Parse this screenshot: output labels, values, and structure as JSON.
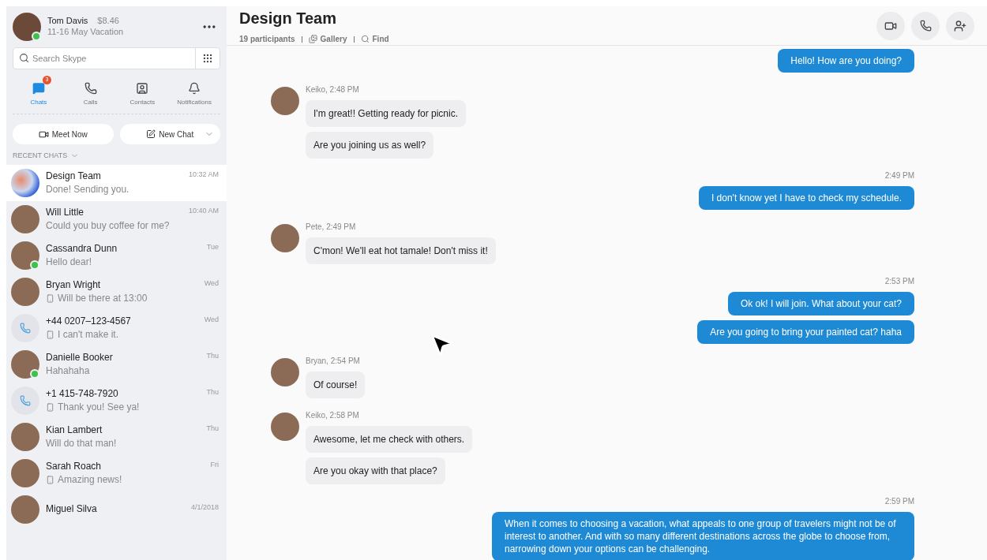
{
  "profile": {
    "name": "Tom Davis",
    "credit": "$8.46",
    "mood": "11-16 May Vacation",
    "online": true
  },
  "search": {
    "placeholder": "Search Skype"
  },
  "nav_tabs": [
    {
      "label": "Chats",
      "selected": true,
      "badge": "3",
      "kind": "chats"
    },
    {
      "label": "Calls",
      "selected": false,
      "kind": "calls"
    },
    {
      "label": "Contacts",
      "selected": false,
      "kind": "contacts"
    },
    {
      "label": "Notifications",
      "selected": false,
      "kind": "notifications"
    }
  ],
  "actions": {
    "meet_now": "Meet Now",
    "new_chat": "New Chat"
  },
  "recent_chats_label": "RECENT CHATS",
  "chats": [
    {
      "name": "Design Team",
      "preview": "Done! Sending you.",
      "time": "10:32 AM",
      "selected": true,
      "online": false,
      "mobile": false,
      "kind": "group"
    },
    {
      "name": "Will Little",
      "preview": "Could you buy coffee for me?",
      "time": "10:40 AM",
      "selected": false,
      "online": false,
      "mobile": false,
      "kind": "person"
    },
    {
      "name": "Cassandra Dunn",
      "preview": "Hello dear!",
      "time": "Tue",
      "selected": false,
      "online": true,
      "mobile": false,
      "kind": "person"
    },
    {
      "name": "Bryan Wright",
      "preview": "Will be there at 13:00",
      "time": "Wed",
      "selected": false,
      "online": false,
      "mobile": true,
      "kind": "person"
    },
    {
      "name": "+44 0207–123-4567",
      "preview": "I can't make it.",
      "time": "Wed",
      "selected": false,
      "online": false,
      "mobile": true,
      "kind": "phone"
    },
    {
      "name": "Danielle Booker",
      "preview": "Hahahaha",
      "time": "Thu",
      "selected": false,
      "online": true,
      "mobile": false,
      "kind": "person"
    },
    {
      "name": "+1 415-748-7920",
      "preview": "Thank you! See ya!",
      "time": "Thu",
      "selected": false,
      "online": false,
      "mobile": true,
      "kind": "phone"
    },
    {
      "name": "Kian Lambert",
      "preview": "Will do that man!",
      "time": "Thu",
      "selected": false,
      "online": false,
      "mobile": false,
      "kind": "person"
    },
    {
      "name": "Sarah Roach",
      "preview": "Amazing news!",
      "time": "Fri",
      "selected": false,
      "online": false,
      "mobile": true,
      "kind": "person"
    },
    {
      "name": "Miguel Silva",
      "time": "4/1/2018",
      "selected": false,
      "online": false,
      "mobile": false,
      "kind": "person"
    }
  ],
  "conversation": {
    "title": "Design Team",
    "participants": "19 participants",
    "gallery": "Gallery",
    "find": "Find"
  },
  "messages": [
    {
      "kind": "outgoing",
      "texts": [
        "Hello! How are you doing?"
      ]
    },
    {
      "kind": "incoming",
      "header": "Keiko, 2:48 PM",
      "texts": [
        "I'm great!! Getting ready for picnic.",
        "Are you joining us as well?"
      ]
    },
    {
      "kind": "outgoing",
      "header": "2:49 PM",
      "texts": [
        "I don't know yet I have to check my schedule."
      ]
    },
    {
      "kind": "incoming",
      "header": "Pete, 2:49 PM",
      "texts": [
        "C'mon! We'll eat hot tamale! Don't miss it!"
      ]
    },
    {
      "kind": "outgoing",
      "header": "2:53 PM",
      "texts": [
        "Ok ok! I will join. What about your cat?",
        "Are you going to bring your painted cat? haha"
      ]
    },
    {
      "kind": "incoming",
      "header": "Bryan, 2:54 PM",
      "texts": [
        "Of course!"
      ]
    },
    {
      "kind": "incoming",
      "header": "Keiko, 2:58 PM",
      "texts": [
        "Awesome, let me check with others.",
        "Are you okay with that place?"
      ]
    },
    {
      "kind": "outgoing",
      "header": "2:59 PM",
      "texts": [
        "When it comes to choosing a vacation, what appeals to one group of travelers might not be of interest to another. And with so many different destinations across the globe to choose from, narrowing down your options can be challenging."
      ]
    }
  ]
}
